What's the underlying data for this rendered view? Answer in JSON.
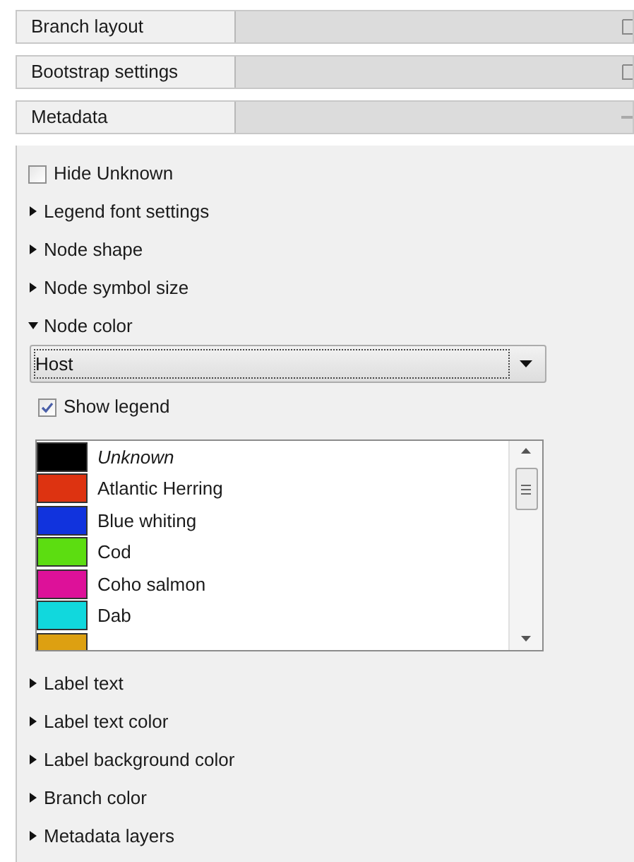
{
  "panels": [
    {
      "title": "Branch layout",
      "expanded": false
    },
    {
      "title": "Bootstrap settings",
      "expanded": false
    },
    {
      "title": "Metadata",
      "expanded": true
    }
  ],
  "hide_unknown": {
    "label": "Hide Unknown",
    "checked": false
  },
  "sections_top": [
    {
      "label": "Legend font settings",
      "expanded": false
    },
    {
      "label": "Node shape",
      "expanded": false
    },
    {
      "label": "Node symbol size",
      "expanded": false
    },
    {
      "label": "Node color",
      "expanded": true
    }
  ],
  "node_color": {
    "dropdown": {
      "value": "Host"
    },
    "show_legend": {
      "label": "Show legend",
      "checked": true
    },
    "legend": [
      {
        "label": "Unknown",
        "color": "#000000",
        "italic": true
      },
      {
        "label": "Atlantic Herring",
        "color": "#dd3311",
        "italic": false
      },
      {
        "label": "Blue whiting",
        "color": "#1133dd",
        "italic": false
      },
      {
        "label": "Cod",
        "color": "#5cdd11",
        "italic": false
      },
      {
        "label": "Coho salmon",
        "color": "#dd1199",
        "italic": false
      },
      {
        "label": "Dab",
        "color": "#11d8dd",
        "italic": false
      },
      {
        "color": "#dda011"
      }
    ]
  },
  "sections_bottom": [
    {
      "label": "Label text",
      "expanded": false
    },
    {
      "label": "Label text color",
      "expanded": false
    },
    {
      "label": "Label background color",
      "expanded": false
    },
    {
      "label": "Branch color",
      "expanded": false
    },
    {
      "label": "Metadata layers",
      "expanded": false
    }
  ]
}
